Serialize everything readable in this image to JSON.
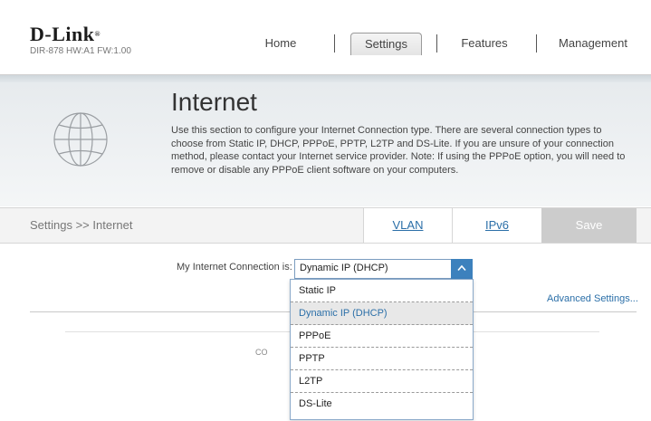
{
  "brand": {
    "logo": "D-Link",
    "model": "DIR-878 HW:A1 FW:1.00"
  },
  "nav": {
    "items": [
      "Home",
      "Settings",
      "Features",
      "Management"
    ],
    "active": "Settings"
  },
  "hero": {
    "title": "Internet",
    "description": "Use this section to configure your Internet Connection type. There are several connection types to choose from Static IP, DHCP, PPPoE, PPTP, L2TP and DS-Lite. If you are unsure of your connection method, please contact your Internet service provider. Note: If using the PPPoE option, you will need to remove or disable any PPPoE client software on your computers.",
    "icon": "globe-icon"
  },
  "crumb": "Settings >> Internet",
  "tabs": {
    "vlan": "VLAN",
    "ipv6": "IPv6"
  },
  "save_label": "Save",
  "form": {
    "connection_label": "My Internet Connection is:",
    "connection_value": "Dynamic IP (DHCP)",
    "options": [
      "Static IP",
      "Dynamic IP (DHCP)",
      "PPPoE",
      "PPTP",
      "L2TP",
      "DS-Lite"
    ],
    "selected": "Dynamic IP (DHCP)"
  },
  "advanced": "Advanced Settings...",
  "footer_frag": "CO",
  "colors": {
    "accent": "#3d81bd",
    "link": "#2b6fa8",
    "save_disabled": "#cccccc"
  }
}
